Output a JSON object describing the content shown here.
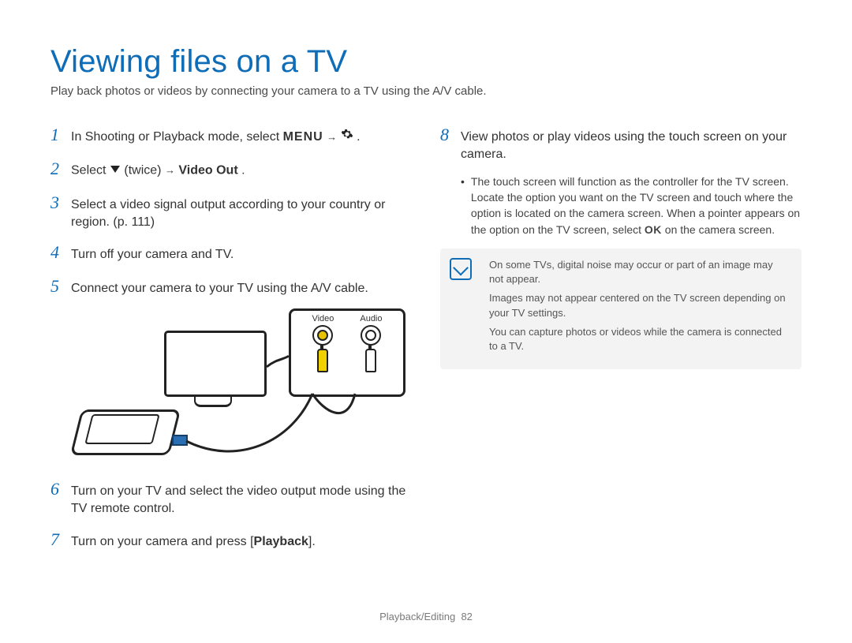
{
  "title": "Viewing files on a TV",
  "intro": "Play back photos or videos by connecting your camera to a TV using the A/V cable.",
  "icons": {
    "menu_label": "MENU",
    "arrow": "→",
    "gear": "gear-icon",
    "down": "down-icon",
    "ok": "OK"
  },
  "steps": [
    {
      "num": "1",
      "pre": "In Shooting or Playback mode, select ",
      "menu": true,
      "post": "."
    },
    {
      "num": "2",
      "pre": "Select ",
      "down": true,
      "mid": " (twice) ",
      "arrow": true,
      "bold": "Video Out",
      "post": "."
    },
    {
      "num": "3",
      "text": "Select a video signal output according to your country or region. (p. 111)"
    },
    {
      "num": "4",
      "text": "Turn off your camera and TV."
    },
    {
      "num": "5",
      "text": "Connect your camera to your TV using the A/V cable."
    },
    {
      "num": "6",
      "text": "Turn on your TV and select the video output mode using the TV remote control."
    },
    {
      "num": "7",
      "pre": "Turn on your camera and press [",
      "bold": "Playback",
      "post": "]."
    },
    {
      "num": "8",
      "text": "View photos or play videos using the touch screen on your camera."
    }
  ],
  "diagram": {
    "video": "Video",
    "audio": "Audio"
  },
  "step8_bullet": {
    "pre": "The touch screen will function as the controller for the TV screen. Locate the option you want on the TV screen and touch where the option is located on the camera screen. When a pointer appears on the option on the TV screen, select ",
    "ok": "OK",
    "post": " on the camera screen."
  },
  "notes": [
    "On some TVs, digital noise may occur or part of an image may not appear.",
    "Images may not appear centered on the TV screen depending on your TV settings.",
    "You can capture photos or videos while the camera is connected to a TV."
  ],
  "footer": {
    "section": "Playback/Editing",
    "page": "82"
  }
}
